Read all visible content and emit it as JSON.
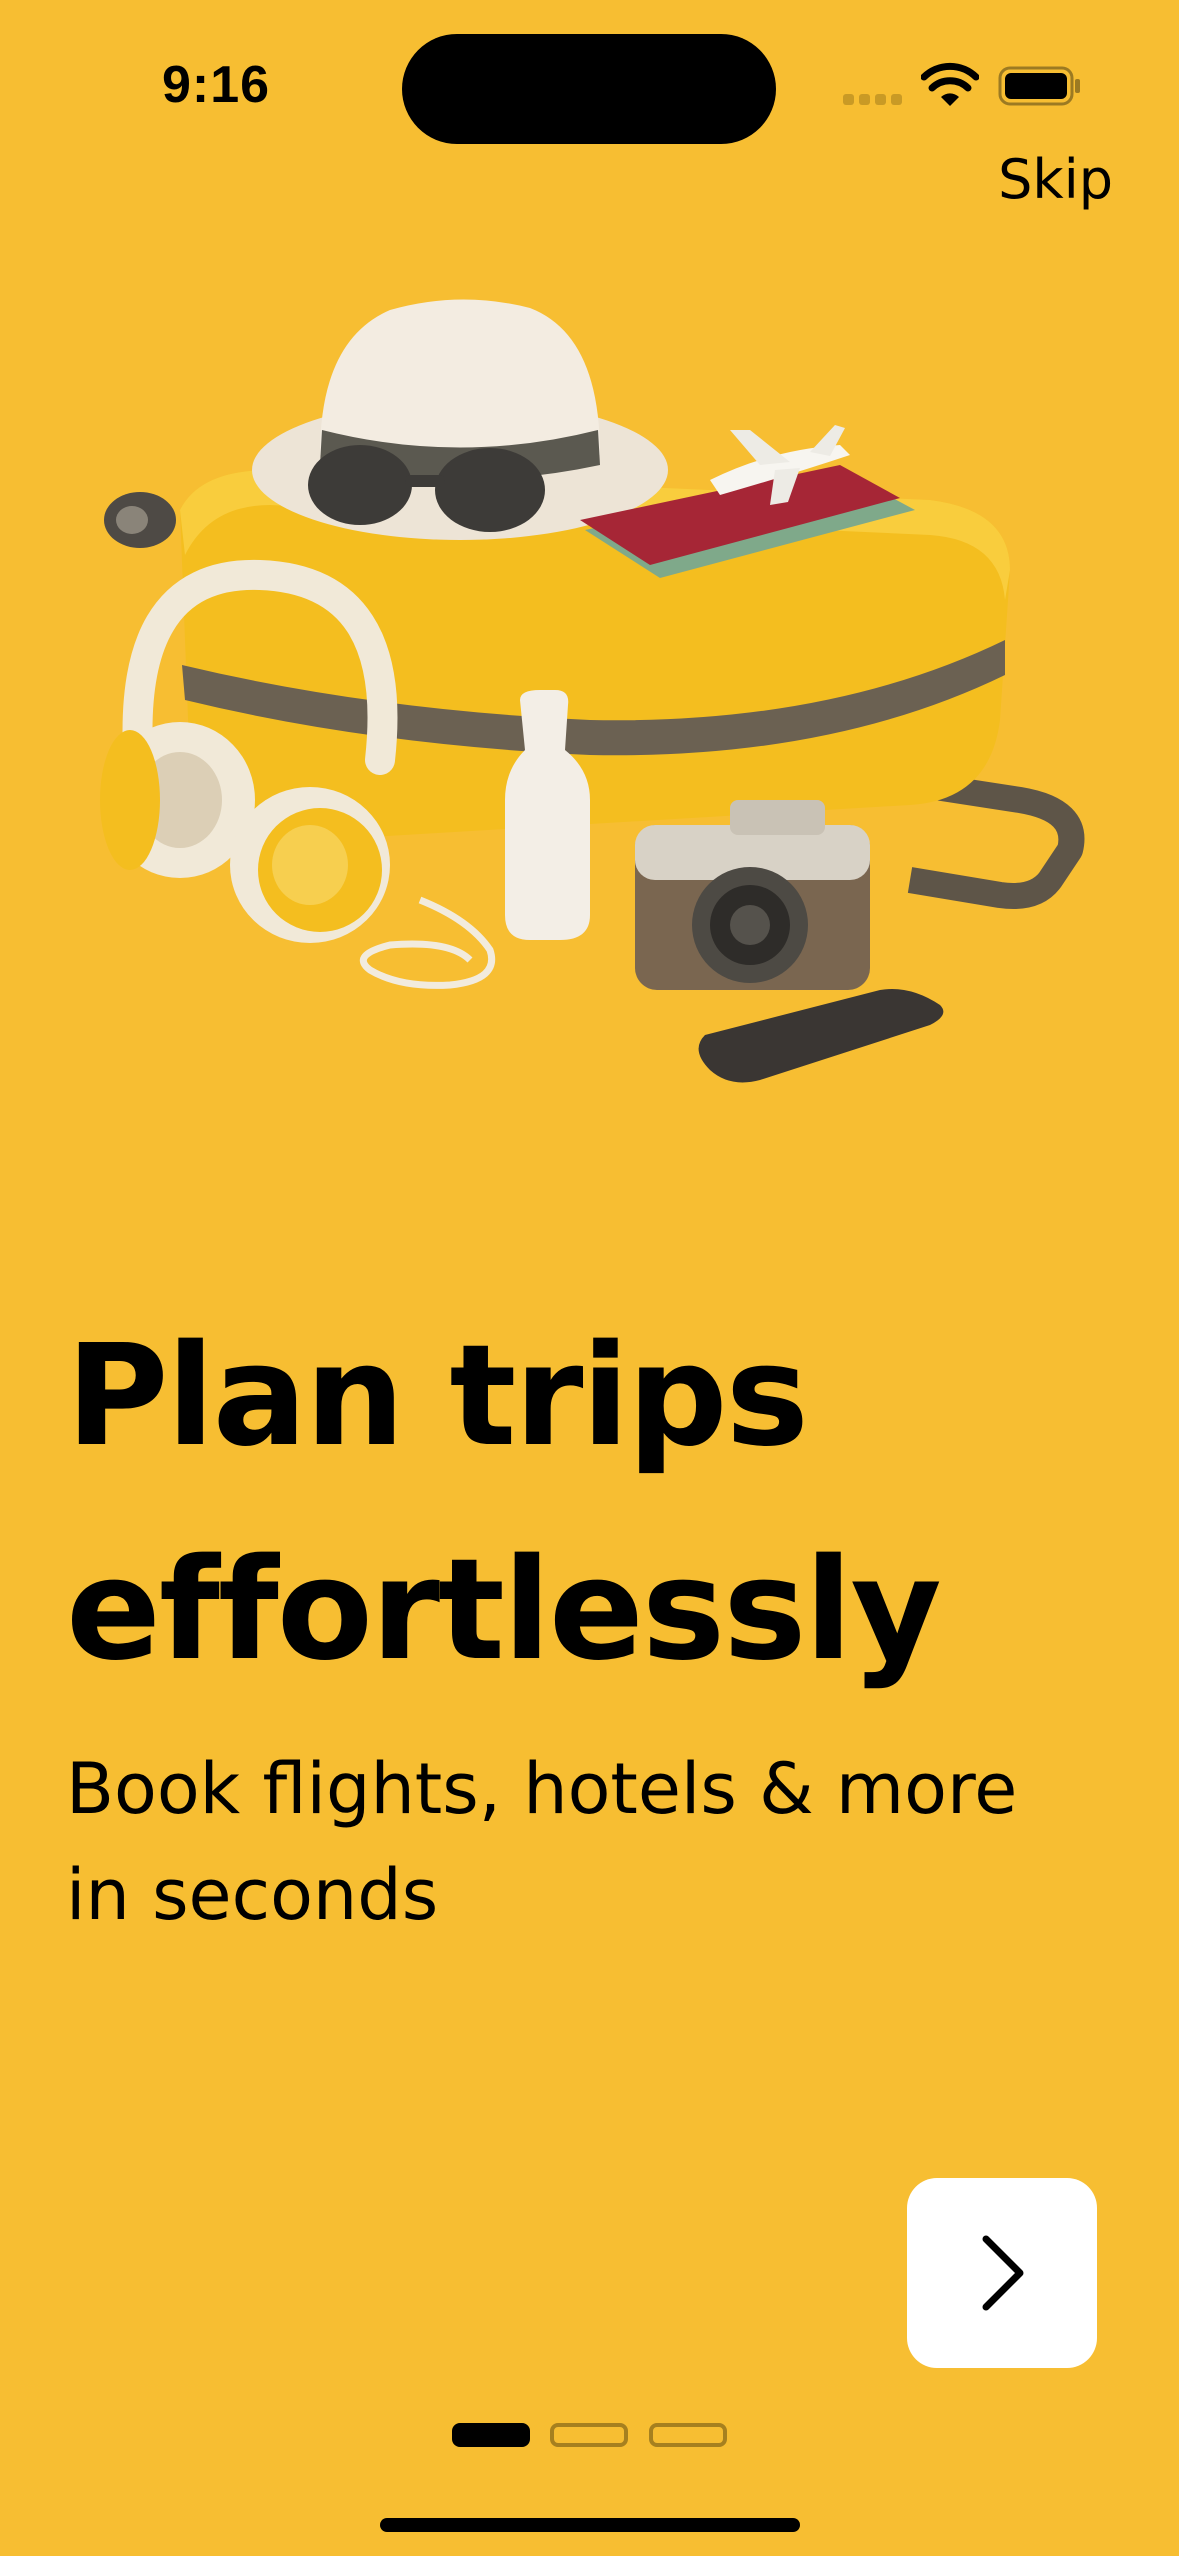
{
  "status_bar": {
    "time": "9:16"
  },
  "onboarding": {
    "skip_label": "Skip",
    "headline_line1": "Plan trips",
    "headline_line2": "effortlessly",
    "subtitle_line1": "Book flights, hotels & more",
    "subtitle_line2": "in seconds",
    "next_icon": "chevron-right-icon",
    "page_count": 3,
    "current_page": 1
  },
  "colors": {
    "background": "#F7BE32",
    "button_background": "#FFFFFF",
    "text": "#000000"
  }
}
